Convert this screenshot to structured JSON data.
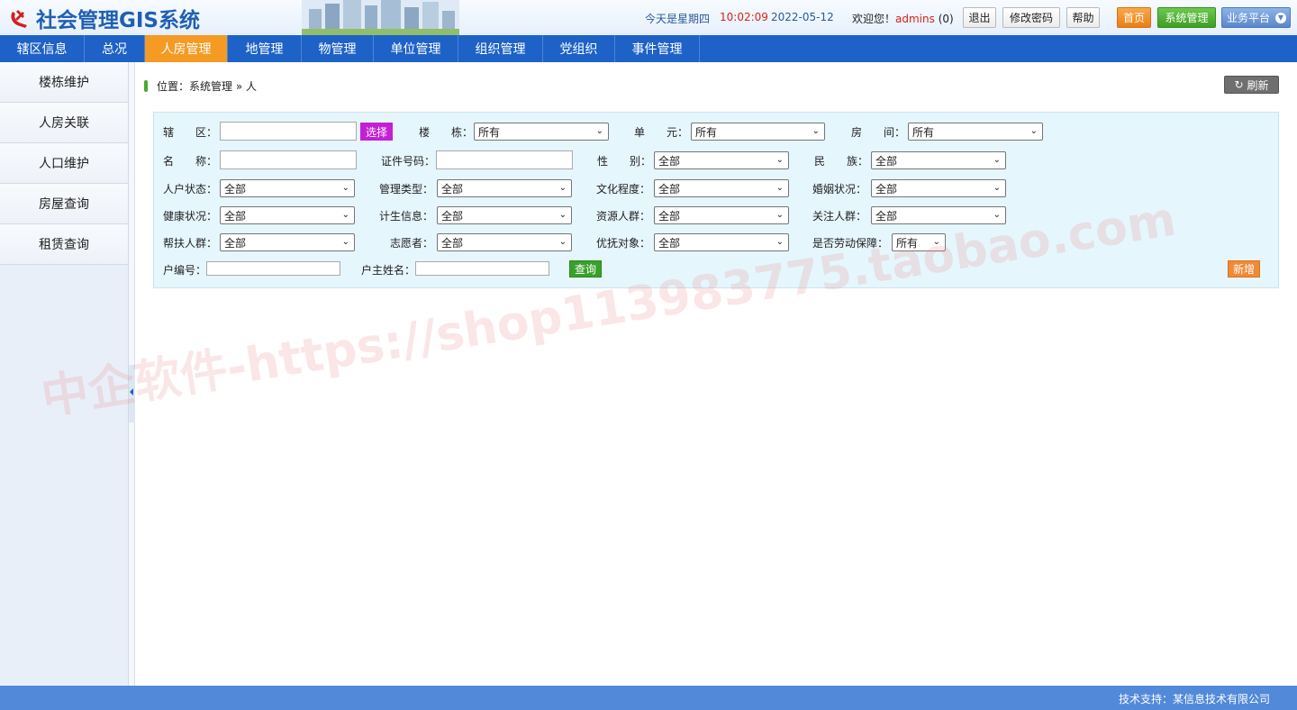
{
  "header": {
    "app_title": "社会管理GIS系统",
    "weekday": "今天是星期四",
    "time": "10:02:09",
    "date": "2022-05-12",
    "welcome_prefix": "欢迎您！",
    "username": "admins",
    "msg_count": "(0)",
    "logout_label": "退出",
    "change_pwd_label": "修改密码",
    "help_label": "帮助",
    "home_label": "首页",
    "sysadmin_label": "系统管理",
    "platform_label": "业务平台"
  },
  "nav": {
    "items": [
      "辖区信息",
      "总况",
      "人房管理",
      "地管理",
      "物管理",
      "单位管理",
      "组织管理",
      "党组织",
      "事件管理"
    ],
    "active_index": 2
  },
  "sidebar": {
    "items": [
      "楼栋维护",
      "人房关联",
      "人口维护",
      "房屋查询",
      "租赁查询"
    ]
  },
  "breadcrumb": {
    "text": "位置：系统管理 » 人"
  },
  "toolbar": {
    "refresh_label": "刷新"
  },
  "form": {
    "district_label": "辖　　区：",
    "choose_label": "选择",
    "building_label": "楼　　栋：",
    "building_value": "所有",
    "unit_label": "单　　元：",
    "unit_value": "所有",
    "room_label": "房　　间：",
    "room_value": "所有",
    "name_label": "名　　称：",
    "id_label": "证件号码：",
    "gender_label": "性　　别：",
    "gender_value": "全部",
    "ethnic_label": "民　　族：",
    "ethnic_value": "全部",
    "household_status_label": "人户状态：",
    "household_status_value": "全部",
    "manage_type_label": "管理类型：",
    "manage_type_value": "全部",
    "education_label": "文化程度：",
    "education_value": "全部",
    "marital_label": "婚姻状况：",
    "marital_value": "全部",
    "health_label": "健康状况：",
    "health_value": "全部",
    "family_plan_label": "计生信息：",
    "family_plan_value": "全部",
    "resource_label": "资源人群：",
    "resource_value": "全部",
    "focus_label": "关注人群：",
    "focus_value": "全部",
    "aid_label": "帮扶人群：",
    "aid_value": "全部",
    "volunteer_label": "志愿者：",
    "volunteer_value": "全部",
    "preferential_label": "优抚对象：",
    "preferential_value": "全部",
    "labor_label": "是否劳动保障：",
    "labor_value": "所有",
    "house_no_label": "户编号：",
    "owner_name_label": "户主姓名：",
    "query_label": "查询",
    "add_label": "新增"
  },
  "watermark": "中企软件-https://shop113983775.taobao.com",
  "footer": {
    "text": "技术支持：某信息技术有限公司"
  }
}
